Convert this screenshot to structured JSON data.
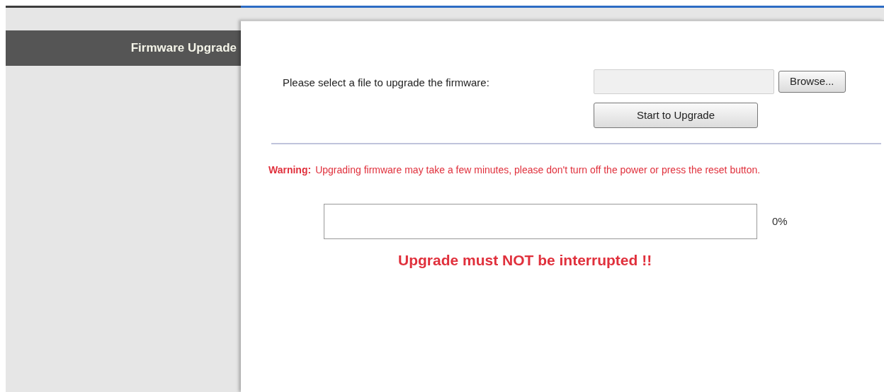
{
  "sidebar": {
    "items": [
      {
        "label": "Firmware Upgrade",
        "selected": true
      }
    ]
  },
  "upgrade": {
    "file_label": "Please select a file to upgrade the firmware:",
    "browse_button": "Browse...",
    "start_button": "Start to Upgrade"
  },
  "warning": {
    "label": "Warning:",
    "text": "Upgrading firmware may take a few minutes, please don't turn off the power or press the reset button."
  },
  "progress": {
    "level": 0,
    "reading": "0%"
  },
  "notice": "Upgrade must NOT be interrupted !!"
}
